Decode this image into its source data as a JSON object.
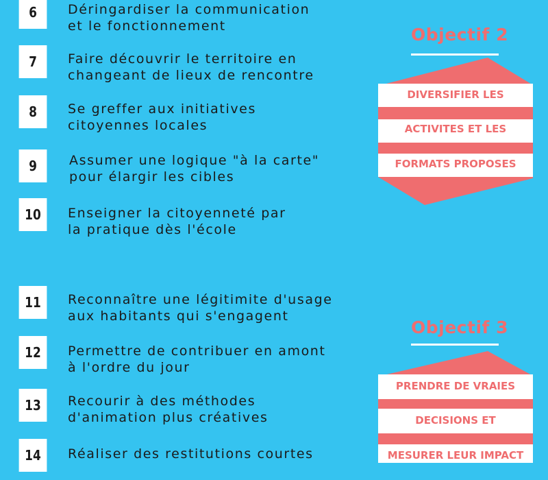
{
  "colors": {
    "background": "#35c3f0",
    "accent": "#ef6d6f",
    "box": "#ffffff",
    "text": "#1a1a1a"
  },
  "items": [
    {
      "number": "6",
      "text": "Déringardiser la communication\net le fonctionnement"
    },
    {
      "number": "7",
      "text": "Faire découvrir le territoire en\nchangeant de lieux de rencontre"
    },
    {
      "number": "8",
      "text": "Se greffer aux initiatives\ncitoyennes locales"
    },
    {
      "number": "9",
      "text": "Assumer une logique \"à la carte\"\npour élargir les cibles"
    },
    {
      "number": "10",
      "text": "Enseigner la citoyenneté par\nla pratique dès l'école"
    },
    {
      "number": "11",
      "text": "Reconnaître une légitimite d'usage\naux habitants qui s'engagent"
    },
    {
      "number": "12",
      "text": "Permettre de contribuer en amont\nà l'ordre du jour"
    },
    {
      "number": "13",
      "text": "Recourir à des méthodes\nd'animation plus créatives"
    },
    {
      "number": "14",
      "text": "Réaliser des restitutions courtes"
    }
  ],
  "objectives": [
    {
      "title": "Objectif 2",
      "lines": [
        "DIVERSIFIER LES",
        "ACTIVITES ET LES",
        "FORMATS PROPOSES"
      ]
    },
    {
      "title": "Objectif 3",
      "lines": [
        "PRENDRE DE VRAIES",
        "DECISIONS ET",
        "MESURER LEUR IMPACT"
      ]
    }
  ]
}
